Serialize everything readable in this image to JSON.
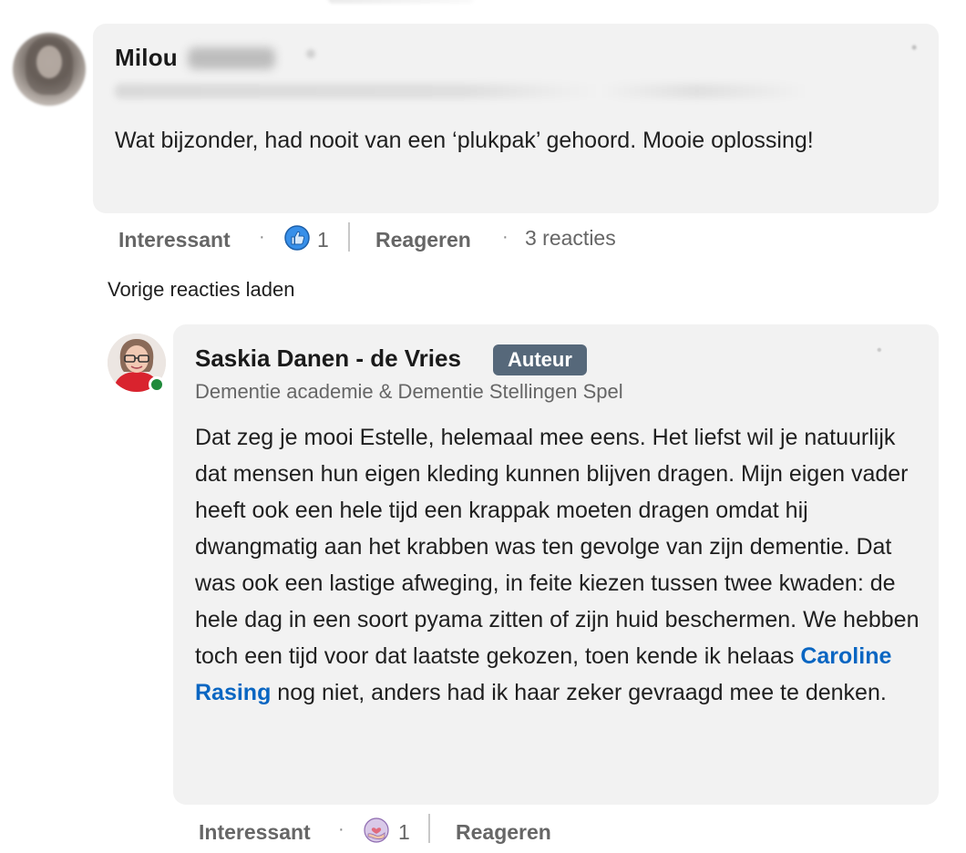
{
  "comment_1": {
    "author_name": "Milou",
    "text": "Wat bijzonder, had nooit van een ‘plukpak’ gehoord. Mooie oplossing!",
    "actions": {
      "like_label": "Interessant",
      "separator": "·",
      "reaction_count": "1",
      "reply_label": "Reageren",
      "reply_count": "3 reacties"
    }
  },
  "load_previous": "Vorige reacties laden",
  "comment_2": {
    "author_name": "Saskia Danen - de Vries",
    "badge": "Auteur",
    "headline": "Dementie academie & Dementie Stellingen Spel",
    "text_before_mention": "Dat zeg je mooi Estelle, helemaal mee eens. Het liefst wil je natuurlijk dat mensen hun eigen kleding kunnen blijven dragen. Mijn eigen vader heeft ook een hele tijd een krappak moeten dragen omdat hij dwangmatig aan het krabben was ten gevolge van zijn dementie. Dat was ook een lastige afweging, in feite kiezen tussen twee kwaden: de hele dag in een soort pyama zitten of zijn huid beschermen. We hebben toch een tijd voor dat laatste gekozen, toen kende ik helaas ",
    "mention": "Caroline Rasing",
    "text_after_mention": " nog niet, anders had ik haar zeker gevraagd mee te denken.",
    "actions": {
      "like_label": "Interessant",
      "separator": "·",
      "reaction_count": "1",
      "reply_label": "Reageren"
    }
  },
  "colors": {
    "bubble_bg": "#f2f2f2",
    "mention": "#0a66c2",
    "badge_bg": "#56687a",
    "online": "#1f8a3a",
    "like_blue": "#378fe9"
  },
  "icons": {
    "reaction_1": "thumbs-up-like-icon",
    "reaction_2": "heart-in-hand-support-icon",
    "more_1": "more-options-icon",
    "more_2": "more-options-icon"
  }
}
